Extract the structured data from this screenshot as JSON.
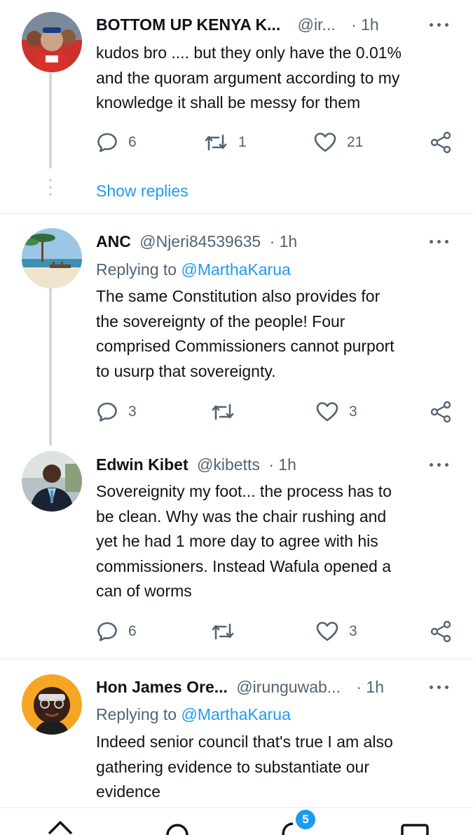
{
  "tweets": [
    {
      "name": "BOTTOM UP KENYA K...",
      "handle": "@ir...",
      "time": "· 1h",
      "body": "kudos bro .... but they only have the 0.01%\nand the quoram argument according to my\nknowledge it shall be messy for them",
      "replies": "6",
      "retweets": "1",
      "likes": "21"
    },
    {
      "name": "ANC",
      "handle": "@Njeri84539635",
      "time": "· 1h",
      "replying_prefix": "Replying to",
      "replying_to": "@MarthaKarua",
      "body": "The same Constitution also provides for\nthe sovereignty of the people! Four\ncomprised Commissioners cannot purport\nto usurp that sovereignty.",
      "replies": "3",
      "retweets": "",
      "likes": "3"
    },
    {
      "name": "Edwin Kibet",
      "handle": "@kibetts",
      "time": "· 1h",
      "body": "Sovereignity my foot... the process has to\nbe clean. Why was the chair rushing and\nyet he had 1 more day to agree with his\ncommissioners. Instead Wafula opened a\ncan of worms",
      "replies": "6",
      "retweets": "",
      "likes": "3"
    },
    {
      "name": "Hon James Ore...",
      "handle": "@irunguwab...",
      "time": "· 1h",
      "replying_prefix": "Replying to",
      "replying_to": "@MarthaKarua",
      "body": "Indeed senior council that's true I am also\ngathering evidence to substantiate our\nevidence"
    }
  ],
  "show_replies": "Show replies",
  "bottom_nav": {
    "items": [
      "home-icon",
      "search-icon",
      "notifications-icon",
      "messages-icon"
    ],
    "notifications_badge": "5"
  },
  "colors": {
    "accent": "#1d9bf0",
    "text": "#0f1419",
    "secondary": "#536471",
    "divider": "#eff3f4"
  }
}
